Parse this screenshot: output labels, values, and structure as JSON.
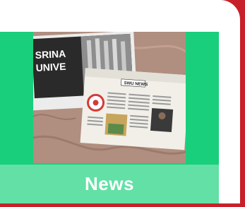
{
  "tile": {
    "label": "News",
    "colors": {
      "tile_background": "#19cf7b",
      "label_background": "#63e0a6",
      "label_text": "#ffffff",
      "frame_accent": "#c8202a"
    }
  },
  "photo": {
    "poster_text_line1": "SRINA",
    "poster_text_line2": "UNIVE",
    "newspaper_masthead": "SWU NEWS"
  }
}
